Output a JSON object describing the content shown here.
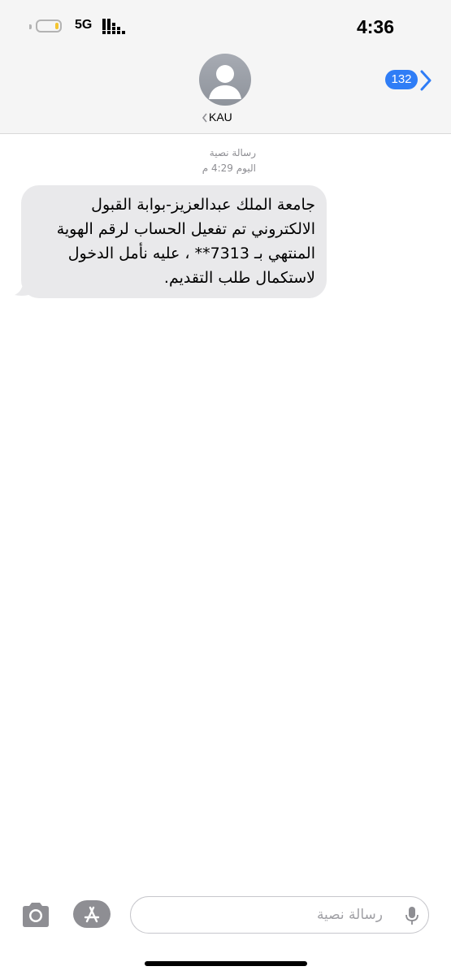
{
  "status_bar": {
    "time": "4:36",
    "network": "5G",
    "battery_level": 0.15,
    "battery_color": "#f4c531"
  },
  "header": {
    "contact_name": "KAU",
    "unread_count": "132",
    "avatar_icon": "person-silhouette-icon",
    "back_icon": "chevron-left-icon",
    "forward_icon": "chevron-right-icon",
    "accent_color": "#2f7df6"
  },
  "conversation": {
    "message_type_label": "رسالة نصية",
    "timestamp": "اليوم 4:29 م",
    "messages": [
      {
        "direction": "incoming",
        "text": "جامعة الملك عبدالعزيز-بوابة القبول الالكتروني تم تفعيل الحساب لرقم الهوية المنتهي بـ 7313** ، عليه نأمل الدخول لاستكمال طلب التقديم."
      }
    ]
  },
  "composer": {
    "placeholder": "رسالة نصية",
    "camera_icon": "camera-icon",
    "apps_icon": "app-store-icon",
    "mic_icon": "microphone-icon"
  }
}
